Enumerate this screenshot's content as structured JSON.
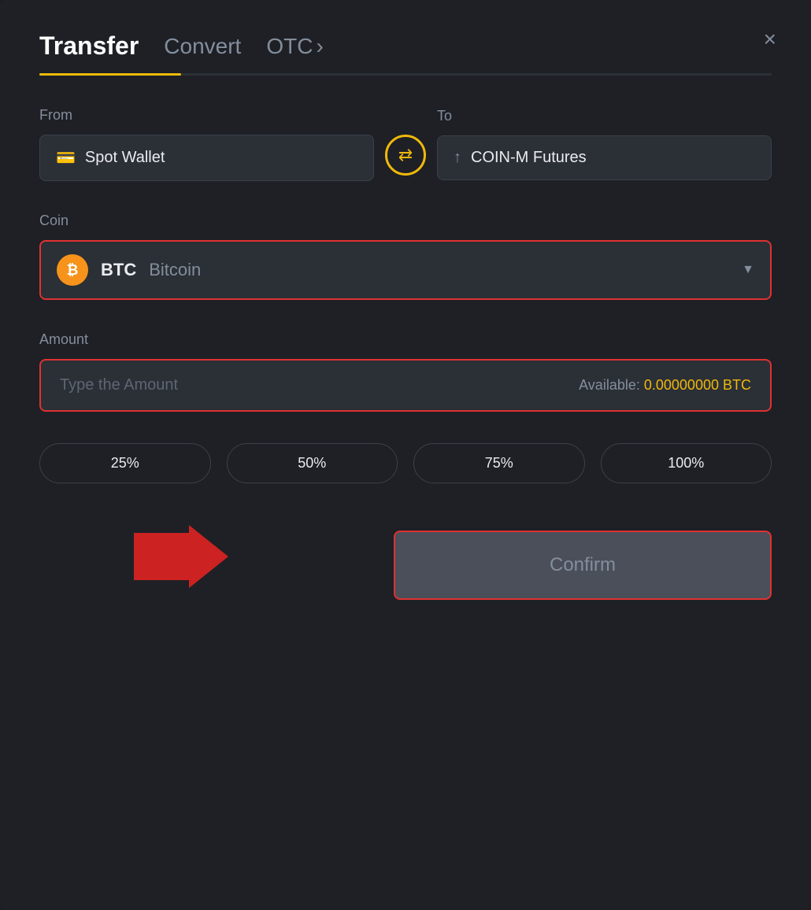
{
  "header": {
    "title": "Transfer",
    "tabs": [
      {
        "label": "Convert",
        "active": false
      },
      {
        "label": "OTC",
        "active": false,
        "has_arrow": true
      }
    ],
    "close_label": "×"
  },
  "from": {
    "label": "From",
    "wallet_icon": "💳",
    "wallet_label": "Spot Wallet"
  },
  "to": {
    "label": "To",
    "futures_icon": "↑",
    "futures_label": "COIN-M Futures"
  },
  "coin": {
    "label": "Coin",
    "btc_symbol": "BTC",
    "btc_full": "Bitcoin",
    "btc_icon_letter": "₿"
  },
  "amount": {
    "label": "Amount",
    "placeholder": "Type the Amount",
    "available_label": "Available:",
    "available_value": "0.00000000",
    "available_currency": "BTC"
  },
  "percentages": [
    "25%",
    "50%",
    "75%",
    "100%"
  ],
  "confirm": {
    "label": "Confirm"
  }
}
